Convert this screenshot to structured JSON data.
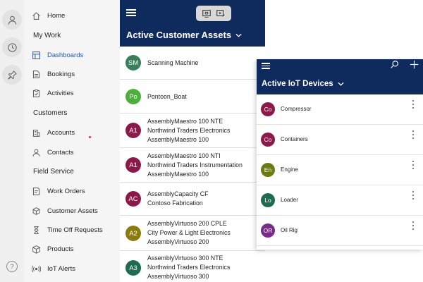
{
  "rail": {
    "help_glyph": "?"
  },
  "sitemap": {
    "home": "Home",
    "sections": [
      {
        "title": "My Work",
        "items": [
          {
            "label": "Dashboards",
            "icon": "dashboard-icon",
            "active": true
          },
          {
            "label": "Bookings",
            "icon": "bookings-icon"
          },
          {
            "label": "Activities",
            "icon": "clipboard-icon"
          }
        ]
      },
      {
        "title": "Customers",
        "items": [
          {
            "label": "Accounts",
            "icon": "building-icon"
          },
          {
            "label": "Contacts",
            "icon": "person-icon"
          }
        ]
      },
      {
        "title": "Field Service",
        "items": [
          {
            "label": "Work Orders",
            "icon": "work-order-icon"
          },
          {
            "label": "Customer Assets",
            "icon": "cube-icon"
          },
          {
            "label": "Time Off Requests",
            "icon": "hourglass-icon"
          },
          {
            "label": "Products",
            "icon": "box-icon"
          },
          {
            "label": "IoT Alerts",
            "icon": "iot-alert-icon"
          }
        ]
      }
    ],
    "active_color": "#2b5797"
  },
  "assets_panel": {
    "title": "Active Customer Assets",
    "header_color": "#0f2a5c",
    "rows": [
      {
        "initials": "SM",
        "color": "#3a7d5a",
        "lines": [
          "Scanning Machine"
        ]
      },
      {
        "initials": "Po",
        "color": "#4caf3a",
        "lines": [
          "Pontoon_Boat"
        ]
      },
      {
        "initials": "A1",
        "color": "#8b1a4a",
        "lines": [
          "AssemblyMaestro 100 NTE",
          "Northwind Traders Electronics",
          "AssemblyMaestro 100"
        ]
      },
      {
        "initials": "A1",
        "color": "#8b1a4a",
        "lines": [
          "AssemblyMaestro 100 NTI",
          "Northwind Traders Instrumentation",
          "AssemblyMaestro 100"
        ]
      },
      {
        "initials": "AC",
        "color": "#8b1a4a",
        "lines": [
          "AssemblyCapacity CF",
          "Contoso Fabrication"
        ]
      },
      {
        "initials": "A2",
        "color": "#8a7a10",
        "lines": [
          "AssemblyVirtuoso 200 CPLE",
          "City Power & Light Electronics",
          "AssemblyVirtuoso 200"
        ]
      },
      {
        "initials": "A3",
        "color": "#1f6b4f",
        "lines": [
          "AssemblyVirtuoso 300 NTE",
          "Northwind Traders Electronics",
          "AssemblyVirtuoso 300"
        ]
      }
    ]
  },
  "iot_panel": {
    "title": "Active IoT Devices",
    "rows": [
      {
        "initials": "Co",
        "color": "#8b1a4a",
        "label": "Compressor"
      },
      {
        "initials": "Co",
        "color": "#8b1a4a",
        "label": "Containers"
      },
      {
        "initials": "En",
        "color": "#6b7a12",
        "label": "Engine"
      },
      {
        "initials": "Lo",
        "color": "#1f6b4f",
        "label": "Loader"
      },
      {
        "initials": "OR",
        "color": "#7a2a8a",
        "label": "Oil Rig"
      }
    ]
  }
}
